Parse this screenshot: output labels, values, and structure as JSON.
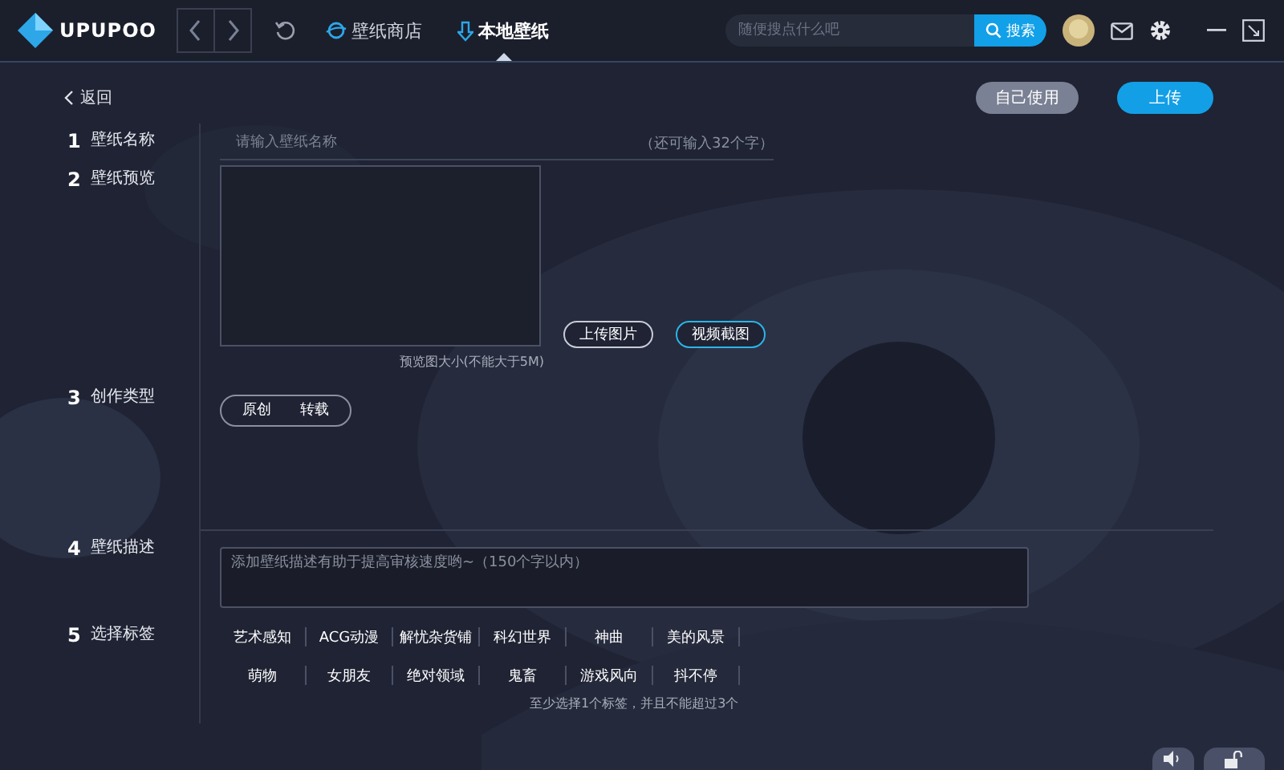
{
  "topbar": {
    "logo": "UPUPOO",
    "nav": [
      {
        "label": "壁纸商店",
        "selected": false
      },
      {
        "label": "本地壁纸",
        "selected": true
      }
    ],
    "search": {
      "placeholder": "随便搜点什么吧",
      "button": "搜索"
    }
  },
  "back": "返回",
  "actions": [
    {
      "label": "自己使用",
      "kind": "secondary"
    },
    {
      "label": "上传",
      "kind": "primary"
    }
  ],
  "steps": [
    {
      "number": "1",
      "label": "壁纸名称",
      "kind": "name",
      "placeholder": "请输入壁纸名称",
      "counter": "（还可输入32个字）"
    },
    {
      "number": "2",
      "label": "壁纸预览",
      "kind": "preview",
      "hint": "预览图大小(不能大于5M)",
      "buttons": [
        {
          "label": "上传图片",
          "highlighted": false
        },
        {
          "label": "视频截图",
          "highlighted": true
        }
      ]
    },
    {
      "number": "3",
      "label": "创作类型",
      "kind": "type",
      "options": [
        "原创",
        "转载"
      ]
    },
    {
      "number": "4",
      "label": "壁纸描述",
      "kind": "description",
      "placeholder": "添加壁纸描述有助于提高审核速度哟~（150个字以内）"
    },
    {
      "number": "5",
      "label": "选择标签",
      "kind": "tags",
      "tags": [
        [
          "艺术感知",
          "ACG动漫",
          "解忧杂货铺",
          "科幻世界",
          "神曲",
          "美的风景"
        ],
        [
          "萌物",
          "女朋友",
          "绝对领域",
          "鬼畜",
          "游戏风向",
          "抖不停"
        ]
      ],
      "note": "至少选择1个标签，并且不能超过3个"
    }
  ]
}
